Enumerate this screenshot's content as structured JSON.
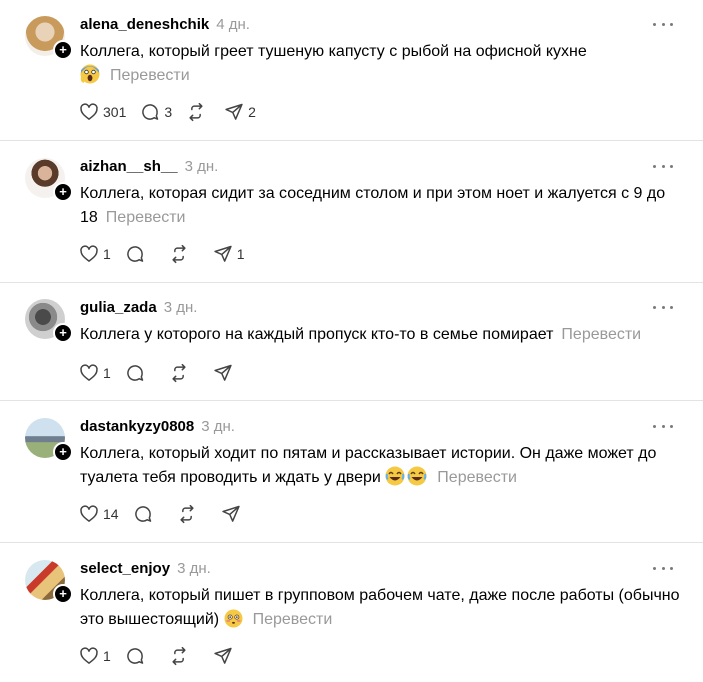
{
  "translate_label": "Перевести",
  "colors": {
    "text": "#000000",
    "muted": "#999999",
    "icon": "#444444",
    "divider": "#e3e3e3"
  },
  "posts": [
    {
      "username": "alena_deneshchik",
      "time": "4 дн.",
      "text": "Коллега, который греет тушеную капусту с рыбой на офисной кухне",
      "emoji": [
        "screaming-face"
      ],
      "likes": "301",
      "comments": "3",
      "reposts": "",
      "shares": "2"
    },
    {
      "username": "aizhan__sh__",
      "time": "3 дн.",
      "text": "Коллега, которая сидит за соседним столом и при этом ноет и жалуется с 9 до 18",
      "emoji": [],
      "likes": "1",
      "comments": "",
      "reposts": "",
      "shares": "1"
    },
    {
      "username": "gulia_zada",
      "time": "3 дн.",
      "text": "Коллега у которого на каждый пропуск кто-то в семье помирает",
      "emoji": [],
      "likes": "1",
      "comments": "",
      "reposts": "",
      "shares": ""
    },
    {
      "username": "dastankyzy0808",
      "time": "3 дн.",
      "text": "Коллега, который ходит по пятам и рассказывает истории. Он даже может до туалета тебя проводить и ждать у двери",
      "emoji": [
        "laughing-face",
        "laughing-face"
      ],
      "likes": "14",
      "comments": "",
      "reposts": "",
      "shares": ""
    },
    {
      "username": "select_enjoy",
      "time": "3 дн.",
      "text": "Коллега, который пишет в групповом рабочем чате, даже после работы (обычно это вышестоящий)",
      "emoji": [
        "flushed-face"
      ],
      "likes": "1",
      "comments": "",
      "reposts": "",
      "shares": ""
    }
  ]
}
